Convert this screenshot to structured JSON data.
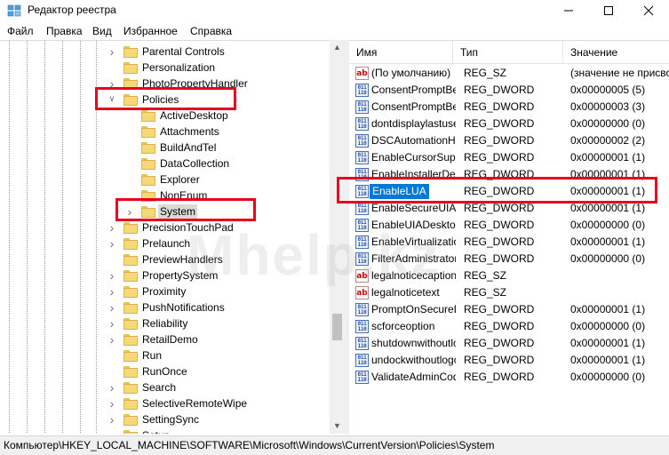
{
  "window": {
    "title": "Редактор реестра"
  },
  "menu": [
    "Файл",
    "Правка",
    "Вид",
    "Избранное",
    "Справка"
  ],
  "tree": {
    "items": [
      {
        "label": "Parental Controls",
        "expander": "collapsed",
        "depth": 0
      },
      {
        "label": "Personalization",
        "expander": "none",
        "depth": 0
      },
      {
        "label": "PhotoPropertyHandler",
        "expander": "collapsed",
        "depth": 0
      },
      {
        "label": "Policies",
        "expander": "expanded",
        "depth": 0
      },
      {
        "label": "ActiveDesktop",
        "expander": "none",
        "depth": 1
      },
      {
        "label": "Attachments",
        "expander": "none",
        "depth": 1
      },
      {
        "label": "BuildAndTel",
        "expander": "none",
        "depth": 1
      },
      {
        "label": "DataCollection",
        "expander": "none",
        "depth": 1
      },
      {
        "label": "Explorer",
        "expander": "none",
        "depth": 1
      },
      {
        "label": "NonEnum",
        "expander": "none",
        "depth": 1
      },
      {
        "label": "System",
        "expander": "collapsed",
        "depth": 1,
        "selected": true
      },
      {
        "label": "PrecisionTouchPad",
        "expander": "collapsed",
        "depth": 0
      },
      {
        "label": "Prelaunch",
        "expander": "collapsed",
        "depth": 0
      },
      {
        "label": "PreviewHandlers",
        "expander": "none",
        "depth": 0
      },
      {
        "label": "PropertySystem",
        "expander": "collapsed",
        "depth": 0
      },
      {
        "label": "Proximity",
        "expander": "collapsed",
        "depth": 0
      },
      {
        "label": "PushNotifications",
        "expander": "collapsed",
        "depth": 0
      },
      {
        "label": "Reliability",
        "expander": "collapsed",
        "depth": 0
      },
      {
        "label": "RetailDemo",
        "expander": "collapsed",
        "depth": 0
      },
      {
        "label": "Run",
        "expander": "none",
        "depth": 0
      },
      {
        "label": "RunOnce",
        "expander": "none",
        "depth": 0
      },
      {
        "label": "Search",
        "expander": "collapsed",
        "depth": 0
      },
      {
        "label": "SelectiveRemoteWipe",
        "expander": "collapsed",
        "depth": 0
      },
      {
        "label": "SettingSync",
        "expander": "collapsed",
        "depth": 0
      },
      {
        "label": "Setup",
        "expander": "collapsed",
        "depth": 0
      }
    ]
  },
  "values_list": {
    "columns": {
      "name": "Имя",
      "type": "Тип",
      "data": "Значение"
    },
    "rows": [
      {
        "icon": "string-value-icon",
        "name": "(По умолчанию)",
        "type": "REG_SZ",
        "data": "(значение не присвоено)"
      },
      {
        "icon": "dword-value-icon",
        "name": "ConsentPromptBehaviorAdmin",
        "type": "REG_DWORD",
        "data": "0x00000005 (5)"
      },
      {
        "icon": "dword-value-icon",
        "name": "ConsentPromptBehaviorUser",
        "type": "REG_DWORD",
        "data": "0x00000003 (3)"
      },
      {
        "icon": "dword-value-icon",
        "name": "dontdisplaylastusername",
        "type": "REG_DWORD",
        "data": "0x00000000 (0)"
      },
      {
        "icon": "dword-value-icon",
        "name": "DSCAutomationHostEnabled",
        "type": "REG_DWORD",
        "data": "0x00000002 (2)"
      },
      {
        "icon": "dword-value-icon",
        "name": "EnableCursorSuppression",
        "type": "REG_DWORD",
        "data": "0x00000001 (1)"
      },
      {
        "icon": "dword-value-icon",
        "name": "EnableInstallerDetection",
        "type": "REG_DWORD",
        "data": "0x00000001 (1)"
      },
      {
        "icon": "dword-value-icon",
        "name": "EnableLUA",
        "type": "REG_DWORD",
        "data": "0x00000001 (1)",
        "selected": true
      },
      {
        "icon": "dword-value-icon",
        "name": "EnableSecureUIAPaths",
        "type": "REG_DWORD",
        "data": "0x00000001 (1)"
      },
      {
        "icon": "dword-value-icon",
        "name": "EnableUIADesktopToggle",
        "type": "REG_DWORD",
        "data": "0x00000000 (0)"
      },
      {
        "icon": "dword-value-icon",
        "name": "EnableVirtualization",
        "type": "REG_DWORD",
        "data": "0x00000001 (1)"
      },
      {
        "icon": "dword-value-icon",
        "name": "FilterAdministratorToken",
        "type": "REG_DWORD",
        "data": "0x00000000 (0)"
      },
      {
        "icon": "string-value-icon",
        "name": "legalnoticecaption",
        "type": "REG_SZ",
        "data": ""
      },
      {
        "icon": "string-value-icon",
        "name": "legalnoticetext",
        "type": "REG_SZ",
        "data": ""
      },
      {
        "icon": "dword-value-icon",
        "name": "PromptOnSecureDesktop",
        "type": "REG_DWORD",
        "data": "0x00000001 (1)"
      },
      {
        "icon": "dword-value-icon",
        "name": "scforceoption",
        "type": "REG_DWORD",
        "data": "0x00000000 (0)"
      },
      {
        "icon": "dword-value-icon",
        "name": "shutdownwithoutlogon",
        "type": "REG_DWORD",
        "data": "0x00000001 (1)"
      },
      {
        "icon": "dword-value-icon",
        "name": "undockwithoutlogon",
        "type": "REG_DWORD",
        "data": "0x00000001 (1)"
      },
      {
        "icon": "dword-value-icon",
        "name": "ValidateAdminCodeSignatures",
        "type": "REG_DWORD",
        "data": "0x00000000 (0)"
      }
    ]
  },
  "statusbar": {
    "path": "Компьютер\\HKEY_LOCAL_MACHINE\\SOFTWARE\\Microsoft\\Windows\\CurrentVersion\\Policies\\System"
  },
  "watermark": "Mhelp.kz",
  "colors": {
    "selection": "#0078d7",
    "annotation_red": "#e8001f",
    "folder": "#f6d877"
  }
}
